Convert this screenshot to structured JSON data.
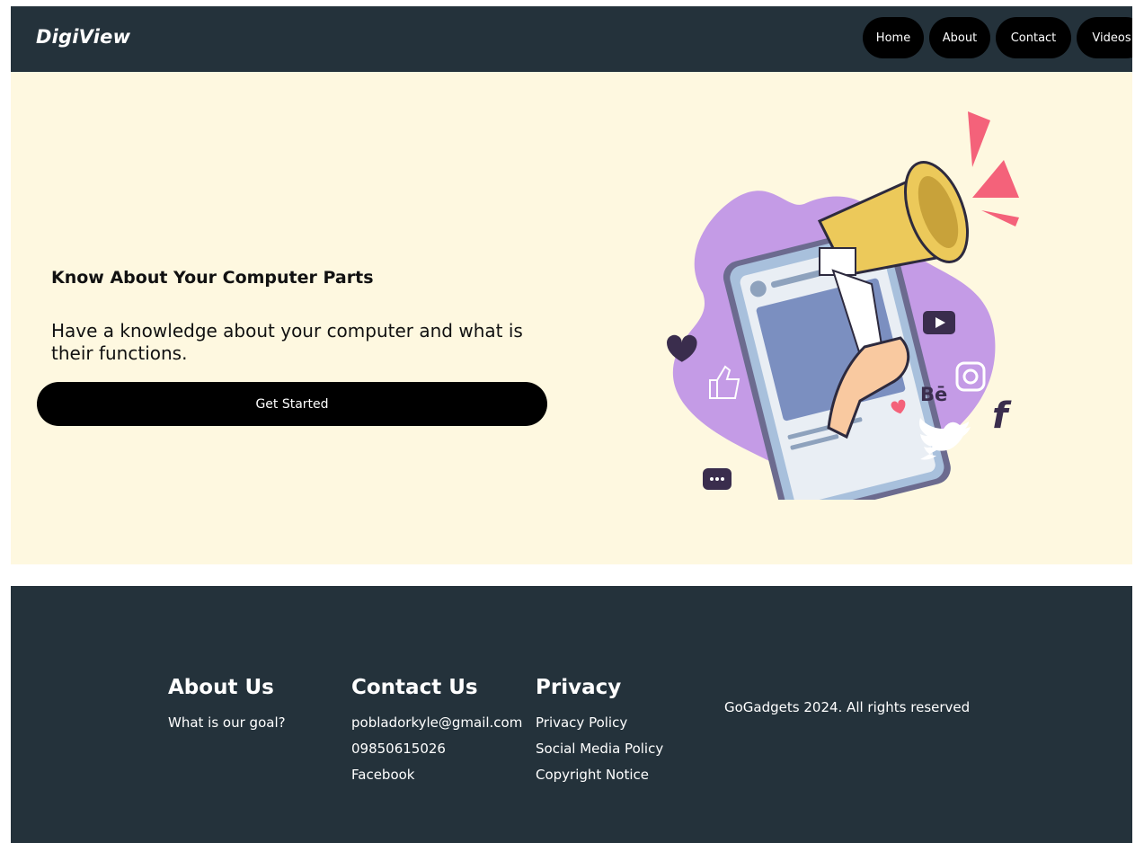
{
  "header": {
    "logo": "DigiView",
    "nav": [
      "Home",
      "About",
      "Contact",
      "Videos"
    ]
  },
  "hero": {
    "title": "Know About Your Computer Parts",
    "text": "Have a knowledge about your computer and what is their functions.",
    "cta_label": "Get Started",
    "illustration_icons": [
      "megaphone-icon",
      "smartphone-icon",
      "heart-icon",
      "like-icon",
      "chat-icon",
      "youtube-icon",
      "instagram-icon",
      "behance-icon",
      "twitter-icon",
      "facebook-icon"
    ],
    "illustration_text": {
      "behance": "Bē",
      "facebook": "f"
    }
  },
  "footer": {
    "about": {
      "heading": "About Us",
      "links": [
        "What is our goal?"
      ]
    },
    "contact": {
      "heading": "Contact Us",
      "links": [
        "pobladorkyle@gmail.com",
        "09850615026",
        "Facebook"
      ]
    },
    "privacy": {
      "heading": "Privacy",
      "links": [
        "Privacy Policy",
        "Social Media Policy",
        "Copyright Notice"
      ]
    },
    "copyright": "GoGadgets 2024. All rights reserved"
  },
  "colors": {
    "header_bg": "#24323b",
    "hero_bg": "#fef8e0",
    "button_bg": "#000000",
    "blob": "#c49be6",
    "accent_pink": "#f4627a",
    "megaphone_yellow": "#ecc95a"
  }
}
